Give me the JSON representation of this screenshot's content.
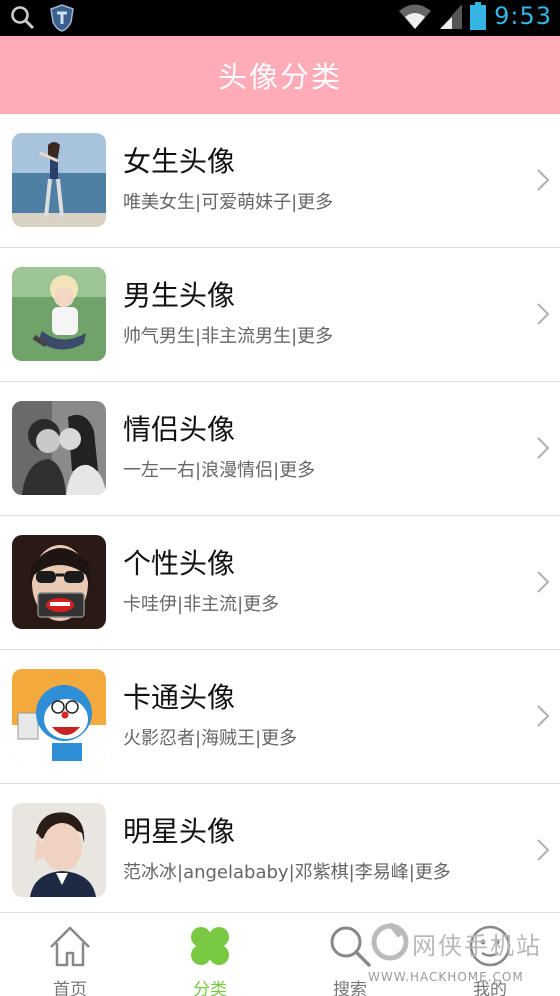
{
  "status_bar": {
    "time": "9:53",
    "icons": [
      "search-icon",
      "shield-icon",
      "wifi-icon",
      "signal-icon",
      "battery-icon"
    ]
  },
  "header": {
    "title": "头像分类"
  },
  "categories": [
    {
      "title": "女生头像",
      "subtitle": "唯美女生|可爱萌妹子|更多",
      "thumb": "girl-photo"
    },
    {
      "title": "男生头像",
      "subtitle": "帅气男生|非主流男生|更多",
      "thumb": "boy-photo"
    },
    {
      "title": "情侣头像",
      "subtitle": "一左一右|浪漫情侣|更多",
      "thumb": "couple-photo"
    },
    {
      "title": "个性头像",
      "subtitle": "卡哇伊|非主流|更多",
      "thumb": "sunglasses-photo"
    },
    {
      "title": "卡通头像",
      "subtitle": "火影忍者|海贼王|更多",
      "thumb": "cartoon-image"
    },
    {
      "title": "明星头像",
      "subtitle": "范冰冰|angelababy|邓紫棋|李易峰|更多",
      "thumb": "star-photo"
    }
  ],
  "bottom_nav": [
    {
      "label": "首页",
      "icon": "home-icon",
      "active": false
    },
    {
      "label": "分类",
      "icon": "clover-icon",
      "active": true
    },
    {
      "label": "搜索",
      "icon": "search-icon",
      "active": false
    },
    {
      "label": "我的",
      "icon": "face-icon",
      "active": false
    }
  ],
  "watermark": {
    "text": "网侠手机站",
    "url": "WWW.HACKHOME.COM"
  },
  "colors": {
    "header_bg": "#ffabb8",
    "active_tab": "#79c943",
    "time": "#35b5e5"
  }
}
